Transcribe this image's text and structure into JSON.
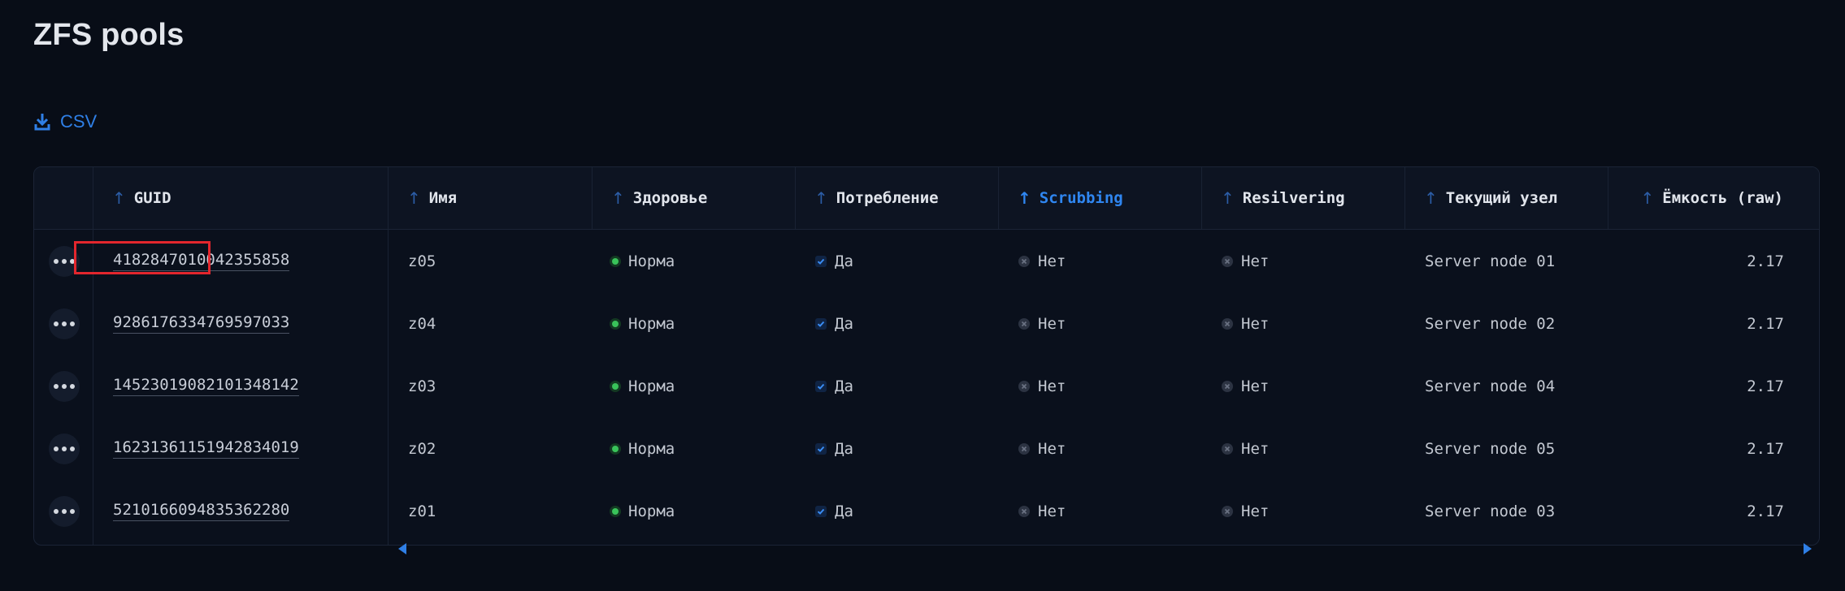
{
  "page": {
    "title": "ZFS pools"
  },
  "toolbar": {
    "csv_label": "CSV",
    "csv_icon": "download-icon"
  },
  "colors": {
    "accent": "#2f7fe6",
    "healthy": "#39c35a",
    "highlight": "#e3262d"
  },
  "table": {
    "columns": [
      {
        "key": "guid",
        "label": "GUID",
        "sort": "asc",
        "active": false
      },
      {
        "key": "name",
        "label": "Имя",
        "sort": "asc",
        "active": false
      },
      {
        "key": "health",
        "label": "Здоровье",
        "sort": "asc",
        "active": false
      },
      {
        "key": "consumption",
        "label": "Потребление",
        "sort": "asc",
        "active": false
      },
      {
        "key": "scrubbing",
        "label": "Scrubbing",
        "sort": "asc",
        "active": true
      },
      {
        "key": "resilvering",
        "label": "Resilvering",
        "sort": "asc",
        "active": false
      },
      {
        "key": "node",
        "label": "Текущий узел",
        "sort": "asc",
        "active": false
      },
      {
        "key": "capacity",
        "label": "Ёмкость (raw)",
        "sort": "asc",
        "active": false
      }
    ],
    "rows": [
      {
        "guid": "4182847010042355858",
        "name": "z05",
        "health": "Норма",
        "consumption": "Да",
        "scrubbing": "Нет",
        "resilvering": "Нет",
        "node": "Server node 01",
        "capacity": "2.17",
        "highlighted": true
      },
      {
        "guid": "9286176334769597033",
        "name": "z04",
        "health": "Норма",
        "consumption": "Да",
        "scrubbing": "Нет",
        "resilvering": "Нет",
        "node": "Server node 02",
        "capacity": "2.17"
      },
      {
        "guid": "14523019082101348142",
        "name": "z03",
        "health": "Норма",
        "consumption": "Да",
        "scrubbing": "Нет",
        "resilvering": "Нет",
        "node": "Server node 04",
        "capacity": "2.17"
      },
      {
        "guid": "16231361151942834019",
        "name": "z02",
        "health": "Норма",
        "consumption": "Да",
        "scrubbing": "Нет",
        "resilvering": "Нет",
        "node": "Server node 05",
        "capacity": "2.17"
      },
      {
        "guid": "5210166094835362280",
        "name": "z01",
        "health": "Норма",
        "consumption": "Да",
        "scrubbing": "Нет",
        "resilvering": "Нет",
        "node": "Server node 03",
        "capacity": "2.17"
      }
    ]
  }
}
